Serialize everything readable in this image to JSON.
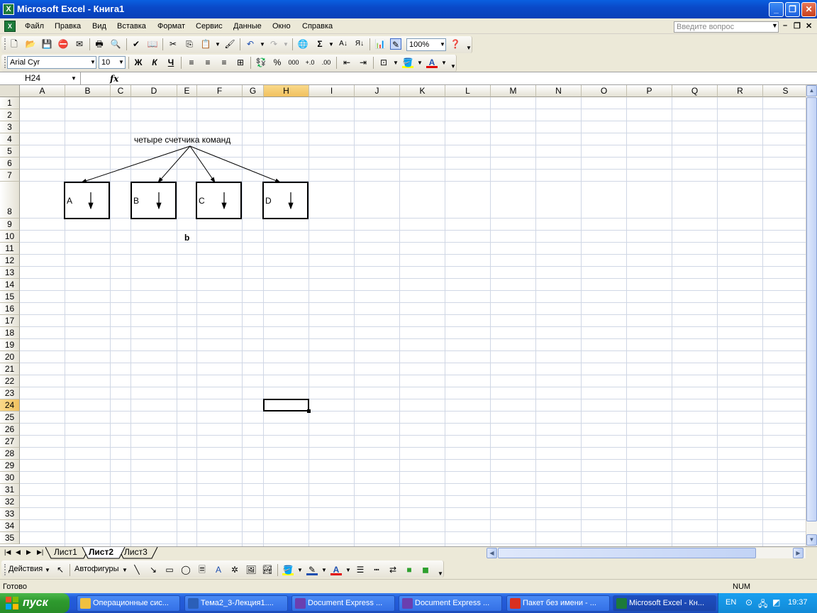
{
  "window": {
    "title": "Microsoft Excel - Книга1",
    "minimize": "_",
    "maximize": "❐",
    "close": "✕"
  },
  "menu": {
    "items": [
      "Файл",
      "Правка",
      "Вид",
      "Вставка",
      "Формат",
      "Сервис",
      "Данные",
      "Окно",
      "Справка"
    ],
    "help_placeholder": "Введите вопрос"
  },
  "toolbar": {
    "zoom": "100%",
    "font_name": "Arial Cyr",
    "font_size": "10",
    "bold_label": "Ж",
    "italic_label": "К",
    "underline_label": "Ч",
    "percent_label": "%",
    "thousands_label": "000"
  },
  "formula_bar": {
    "name_box": "H24",
    "fx_label": "fx",
    "content": ""
  },
  "grid": {
    "columns": [
      "A",
      "B",
      "C",
      "D",
      "E",
      "F",
      "G",
      "H",
      "I",
      "J",
      "K",
      "L",
      "M",
      "N",
      "O",
      "P",
      "Q",
      "R",
      "S"
    ],
    "rows": [
      "1",
      "2",
      "3",
      "4",
      "5",
      "6",
      "7",
      "8",
      "9",
      "10",
      "11",
      "12",
      "13",
      "14",
      "15",
      "16",
      "17",
      "18",
      "19",
      "20",
      "21",
      "22",
      "23",
      "24",
      "25",
      "26",
      "27",
      "28",
      "29",
      "30",
      "31",
      "32",
      "33",
      "34",
      "35"
    ],
    "selected_column": "H",
    "selected_row": "24",
    "selected_cell": "H24"
  },
  "diagram": {
    "header_text": "четыре счетчика команд",
    "boxes": [
      "A",
      "B",
      "C",
      "D"
    ],
    "caption": "b"
  },
  "sheets": {
    "tabs": [
      "Лист1",
      "Лист2",
      "Лист3"
    ],
    "active": "Лист2"
  },
  "draw_toolbar": {
    "actions_label": "Действия",
    "autoshapes_label": "Автофигуры"
  },
  "status": {
    "ready": "Готово",
    "num": "NUM"
  },
  "taskbar": {
    "start_label": "пуск",
    "tasks": [
      {
        "label": "Операционные сис...",
        "color": "#f0c040"
      },
      {
        "label": "Тема2_3-Лекция1....",
        "color": "#2b5fb8"
      },
      {
        "label": "Document Express ...",
        "color": "#6a3fb0"
      },
      {
        "label": "Document Express ...",
        "color": "#6a3fb0"
      },
      {
        "label": "Пакет без имени - ...",
        "color": "#d83020"
      },
      {
        "label": "Microsoft Excel - Кн...",
        "color": "#1d7a3a"
      }
    ],
    "active_task": 5,
    "lang": "EN",
    "clock": "19:37"
  },
  "colors": {
    "title_blue": "#0a49c8",
    "grid_line": "#d0d7e5",
    "selected_header": "#f1c15f",
    "taskbar_blue": "#245edb",
    "start_green": "#2e9a2e"
  }
}
